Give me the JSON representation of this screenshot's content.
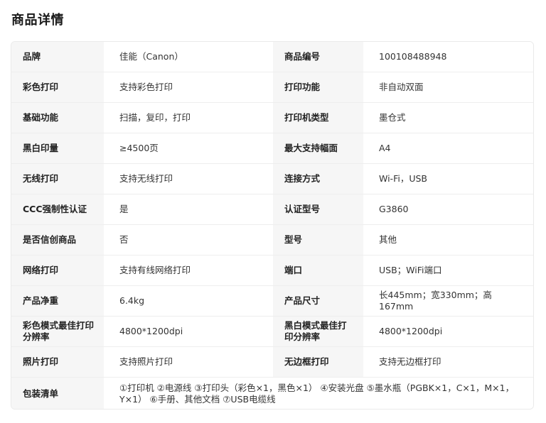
{
  "title": "商品详情",
  "rows": [
    [
      {
        "k": "品牌",
        "v": "佳能（Canon）"
      },
      {
        "k": "商品编号",
        "v": "100108488948"
      }
    ],
    [
      {
        "k": "彩色打印",
        "v": "支持彩色打印"
      },
      {
        "k": "打印功能",
        "v": "非自动双面"
      }
    ],
    [
      {
        "k": "基础功能",
        "v": "扫描，复印，打印"
      },
      {
        "k": "打印机类型",
        "v": "墨仓式"
      }
    ],
    [
      {
        "k": "黑白印量",
        "v": "≥4500页"
      },
      {
        "k": "最大支持幅面",
        "v": "A4"
      }
    ],
    [
      {
        "k": "无线打印",
        "v": "支持无线打印"
      },
      {
        "k": "连接方式",
        "v": "Wi-Fi，USB"
      }
    ],
    [
      {
        "k": "CCC强制性认证",
        "v": "是"
      },
      {
        "k": "认证型号",
        "v": "G3860"
      }
    ],
    [
      {
        "k": "是否信创商品",
        "v": "否"
      },
      {
        "k": "型号",
        "v": "其他"
      }
    ],
    [
      {
        "k": "网络打印",
        "v": "支持有线网络打印"
      },
      {
        "k": "端口",
        "v": "USB；WiFi端口"
      }
    ],
    [
      {
        "k": "产品净重",
        "v": "6.4kg"
      },
      {
        "k": "产品尺寸",
        "v": "长445mm；宽330mm；高167mm"
      }
    ],
    [
      {
        "k": "彩色模式最佳打印分辨率",
        "v": "4800*1200dpi"
      },
      {
        "k": "黑白模式最佳打印分辨率",
        "v": "4800*1200dpi"
      }
    ],
    [
      {
        "k": "照片打印",
        "v": "支持照片打印"
      },
      {
        "k": "无边框打印",
        "v": "支持无边框打印"
      }
    ]
  ],
  "package": {
    "k": "包装清单",
    "v": "①打印机 ②电源线 ③打印头（彩色×1，黑色×1） ④安装光盘 ⑤墨水瓶（PGBK×1，C×1，M×1，Y×1） ⑥手册、其他文档 ⑦USB电缆线"
  }
}
